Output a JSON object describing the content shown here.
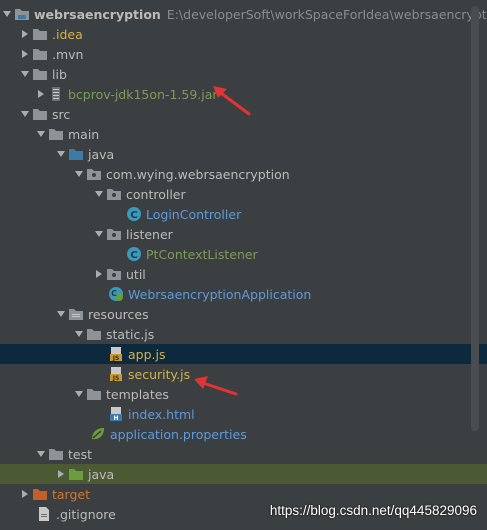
{
  "project": {
    "name": "webrsaencryption",
    "path": "E:\\developerSoft\\workSpaceForIdea\\webrsaencryption"
  },
  "tree": {
    "idea": ".idea",
    "mvn": ".mvn",
    "lib": "lib",
    "jar": "bcprov-jdk15on-1.59.jar",
    "src": "src",
    "main": "main",
    "java": "java",
    "pkg": "com.wying.webrsaencryption",
    "controller": "controller",
    "login_controller": "LoginController",
    "listener": "listener",
    "context_listener": "PtContextListener",
    "util": "util",
    "app_class": "WebrsaencryptionApplication",
    "resources": "resources",
    "static_js": "static.js",
    "app_js": "app.js",
    "security_js": "security.js",
    "templates": "templates",
    "index_html": "index.html",
    "app_props": "application.properties",
    "test": "test",
    "test_java": "java",
    "target": "target",
    "gitignore": ".gitignore"
  },
  "watermark": "https://blog.csdn.net/qq445829096",
  "colors": {
    "background": "#3c3f41",
    "selection": "#0d293e",
    "highlight": "#4b5a33",
    "folder_blue": "#3d7aa8",
    "folder_gray": "#8e9398",
    "folder_orange": "#c0602a",
    "java_class": "#3a98b9",
    "annotation_red": "#e23434"
  },
  "icons": [
    "chevron-down-icon",
    "chevron-right-icon",
    "folder-icon",
    "package-icon",
    "java-class-icon",
    "jar-icon",
    "js-file-icon",
    "html-file-icon",
    "spring-icon",
    "file-icon"
  ]
}
